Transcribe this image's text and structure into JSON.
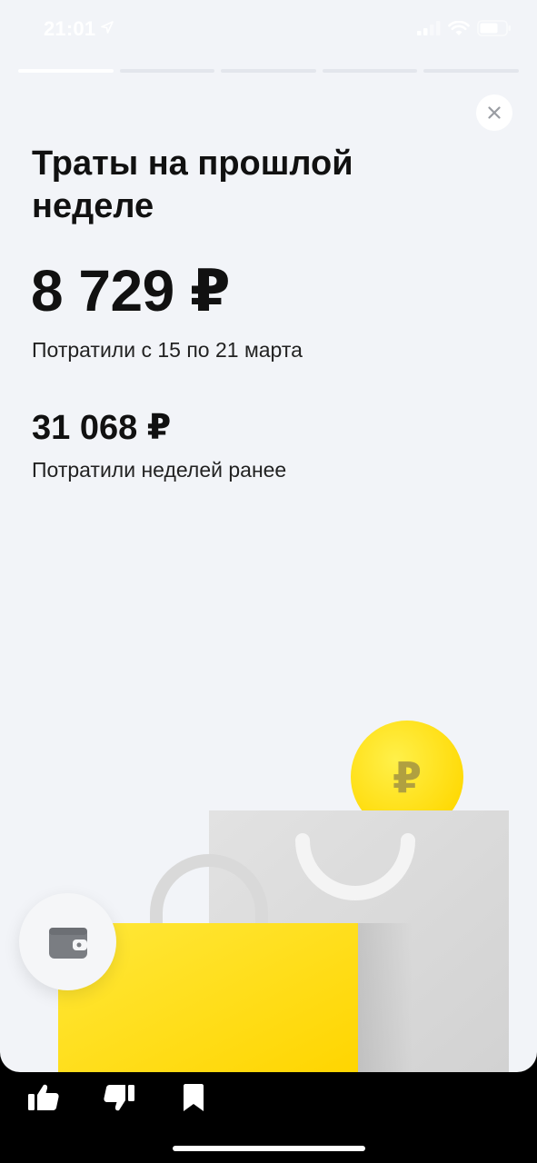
{
  "status_bar": {
    "time": "21:01",
    "icons": [
      "location-arrow-icon",
      "cellular-signal-icon",
      "wifi-icon",
      "battery-icon"
    ]
  },
  "stories_progress": {
    "segments": 5,
    "active_index": 0,
    "active_fill": 1.0
  },
  "close_button": {
    "icon": "close-icon"
  },
  "story": {
    "title": "Траты на прошлой неделе",
    "amount_main": "8 729 ₽",
    "amount_main_caption": "Потратили с 15 по 21 марта",
    "amount_previous": "31 068 ₽",
    "amount_previous_caption": "Потратили неделей ранее"
  },
  "illustration": {
    "coin_symbol": "₽",
    "icons": [
      "ruble-coin-icon",
      "gray-shopping-bag-icon",
      "yellow-shopping-bag-icon"
    ]
  },
  "wallet_button": {
    "icon": "wallet-icon"
  },
  "bottom_actions": [
    {
      "id": "like",
      "icon": "thumbs-up-icon"
    },
    {
      "id": "dislike",
      "icon": "thumbs-down-icon"
    },
    {
      "id": "save",
      "icon": "bookmark-icon"
    }
  ],
  "colors": {
    "background": "#f2f4f8",
    "accent_yellow": "#ffdd2d",
    "text": "#111111",
    "bag_gray": "#dcdcdc"
  }
}
